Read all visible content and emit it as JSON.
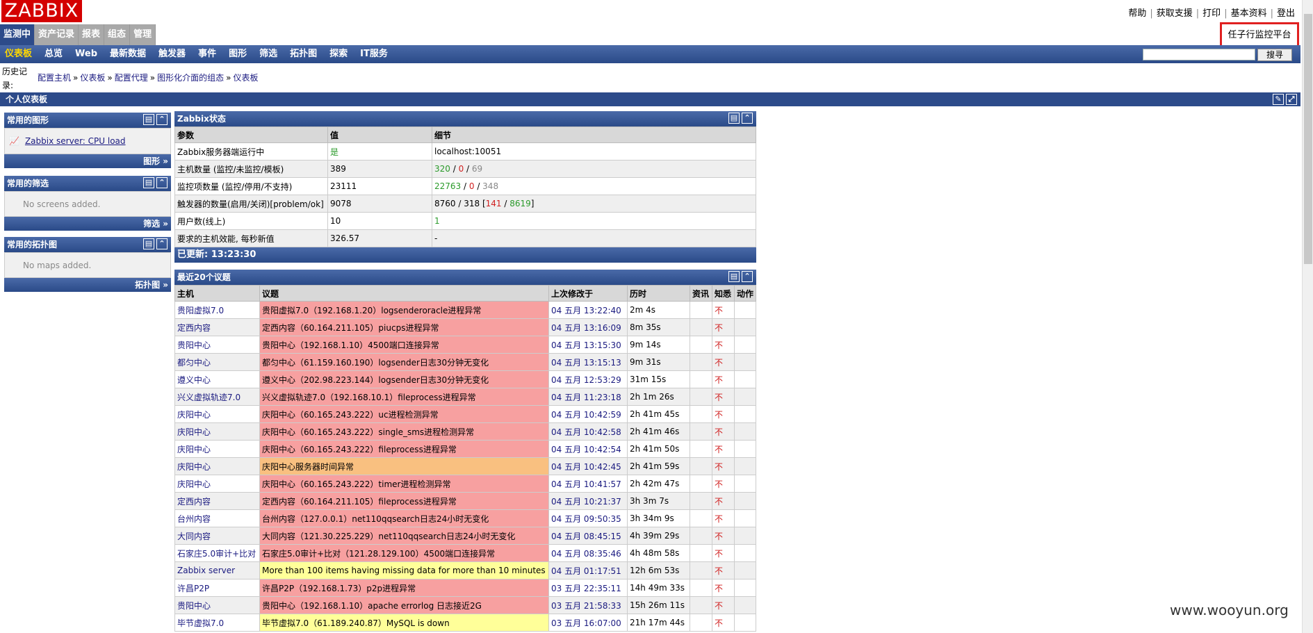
{
  "logo": "ZABBIX",
  "top_links": [
    "帮助",
    "获取支援",
    "打印",
    "基本资料",
    "登出"
  ],
  "main_menu": [
    "监测中",
    "资产记录",
    "报表",
    "组态",
    "管理"
  ],
  "platform_label": "任子行监控平台",
  "sub_menu": [
    "仪表板",
    "总览",
    "Web",
    "最新数据",
    "触发器",
    "事件",
    "图形",
    "筛选",
    "拓扑图",
    "探索",
    "IT服务"
  ],
  "search": {
    "button": "搜寻"
  },
  "history_label": "历史记录:",
  "breadcrumbs": [
    "配置主机",
    "仪表板",
    "配置代理",
    "图形化介面的组态",
    "仪表板"
  ],
  "dashboard_title": "个人仪表板",
  "widgets": {
    "graphs": {
      "title": "常用的图形",
      "item": "Zabbix server: CPU load",
      "footer": "图形 »"
    },
    "screens": {
      "title": "常用的筛选",
      "empty": "No screens added.",
      "footer": "筛选 »"
    },
    "maps": {
      "title": "常用的拓扑图",
      "empty": "No maps added.",
      "footer": "拓扑图 »"
    }
  },
  "status": {
    "title": "Zabbix状态",
    "headers": [
      "参数",
      "值",
      "细节"
    ],
    "rows": [
      {
        "param": "Zabbix服务器端运行中",
        "value": "是",
        "detail": "localhost:10051"
      },
      {
        "param": "主机数量 (监控/未监控/模板)",
        "value": "389",
        "d1": "320",
        "d2": "0",
        "d3": "69"
      },
      {
        "param": "监控项数量 (监控/停用/不支持)",
        "value": "23111",
        "d1": "22763",
        "d2": "0",
        "d3": "348"
      },
      {
        "param": "触发器的数量(启用/关闭)[problem/ok]",
        "value": "9078",
        "d1": "8760",
        "d2": "318",
        "d3": "141",
        "d4": "8619"
      },
      {
        "param": "用户数(线上)",
        "value": "10",
        "detail": "1"
      },
      {
        "param": "要求的主机效能, 每秒新值",
        "value": "326.57",
        "detail": "-"
      }
    ],
    "updated": "已更新: 13:23:30"
  },
  "issues": {
    "title": "最近20个议题",
    "headers": [
      "主机",
      "议题",
      "上次修改于",
      "历时",
      "资讯",
      "知悉",
      "动作"
    ],
    "rows": [
      {
        "host": "贵阳虚拟7.0",
        "issue": "贵阳虚拟7.0（192.168.1.20）logsenderoracle进程异常",
        "time": "04 五月 13:22:40",
        "age": "2m 4s",
        "ack": "不",
        "sev": "red"
      },
      {
        "host": "定西内容",
        "issue": "定西内容（60.164.211.105）piucps进程异常",
        "time": "04 五月 13:16:09",
        "age": "8m 35s",
        "ack": "不",
        "sev": "red"
      },
      {
        "host": "贵阳中心",
        "issue": "贵阳中心（192.168.1.10）4500端口连接异常",
        "time": "04 五月 13:15:30",
        "age": "9m 14s",
        "ack": "不",
        "sev": "red"
      },
      {
        "host": "都匀中心",
        "issue": "都匀中心（61.159.160.190）logsender日志30分钟无变化",
        "time": "04 五月 13:15:13",
        "age": "9m 31s",
        "ack": "不",
        "sev": "red"
      },
      {
        "host": "遵义中心",
        "issue": "遵义中心（202.98.223.144）logsender日志30分钟无变化",
        "time": "04 五月 12:53:29",
        "age": "31m 15s",
        "ack": "不",
        "sev": "red"
      },
      {
        "host": "兴义虚拟轨迹7.0",
        "issue": "兴义虚拟轨迹7.0（192.168.10.1）fileprocess进程异常",
        "time": "04 五月 11:23:18",
        "age": "2h 1m 26s",
        "ack": "不",
        "sev": "red"
      },
      {
        "host": "庆阳中心",
        "issue": "庆阳中心（60.165.243.222）uc进程检测异常",
        "time": "04 五月 10:42:59",
        "age": "2h 41m 45s",
        "ack": "不",
        "sev": "red"
      },
      {
        "host": "庆阳中心",
        "issue": "庆阳中心（60.165.243.222）single_sms进程检测异常",
        "time": "04 五月 10:42:58",
        "age": "2h 41m 46s",
        "ack": "不",
        "sev": "red"
      },
      {
        "host": "庆阳中心",
        "issue": "庆阳中心（60.165.243.222）fileprocess进程异常",
        "time": "04 五月 10:42:54",
        "age": "2h 41m 50s",
        "ack": "不",
        "sev": "red"
      },
      {
        "host": "庆阳中心",
        "issue": "庆阳中心服务器时间异常",
        "time": "04 五月 10:42:45",
        "age": "2h 41m 59s",
        "ack": "不",
        "sev": "orange"
      },
      {
        "host": "庆阳中心",
        "issue": "庆阳中心（60.165.243.222）timer进程检测异常",
        "time": "04 五月 10:41:57",
        "age": "2h 42m 47s",
        "ack": "不",
        "sev": "red"
      },
      {
        "host": "定西内容",
        "issue": "定西内容（60.164.211.105）fileprocess进程异常",
        "time": "04 五月 10:21:37",
        "age": "3h 3m 7s",
        "ack": "不",
        "sev": "red"
      },
      {
        "host": "台州内容",
        "issue": "台州内容（127.0.0.1）net110qqsearch日志24小时无变化",
        "time": "04 五月 09:50:35",
        "age": "3h 34m 9s",
        "ack": "不",
        "sev": "red"
      },
      {
        "host": "大同内容",
        "issue": "大同内容（121.30.225.229）net110qqsearch日志24小时无变化",
        "time": "04 五月 08:45:15",
        "age": "4h 39m 29s",
        "ack": "不",
        "sev": "red"
      },
      {
        "host": "石家庄5.0审计+比对",
        "issue": "石家庄5.0审计+比对（121.28.129.100）4500端口连接异常",
        "time": "04 五月 08:35:46",
        "age": "4h 48m 58s",
        "ack": "不",
        "sev": "red"
      },
      {
        "host": "Zabbix server",
        "issue": "More than 100 items having missing data for more than 10 minutes",
        "time": "04 五月 01:17:51",
        "age": "12h 6m 53s",
        "ack": "不",
        "sev": "yellow"
      },
      {
        "host": "许昌P2P",
        "issue": "许昌P2P（192.168.1.73）p2p进程异常",
        "time": "03 五月 22:35:11",
        "age": "14h 49m 33s",
        "ack": "不",
        "sev": "red"
      },
      {
        "host": "贵阳中心",
        "issue": "贵阳中心（192.168.1.10）apache errorlog 日志接近2G",
        "time": "03 五月 21:58:33",
        "age": "15h 26m 11s",
        "ack": "不",
        "sev": "red"
      },
      {
        "host": "毕节虚拟7.0",
        "issue": "毕节虚拟7.0（61.189.240.87）MySQL is down",
        "time": "03 五月 16:07:00",
        "age": "21h 17m 44s",
        "ack": "不",
        "sev": "yellow"
      }
    ]
  },
  "watermark": "www.wooyun.org",
  "colors": {
    "nav": "#2d4b8a",
    "problem": "#f7a0a0",
    "warning": "#f9c080",
    "info": "#ffff99",
    "logo": "#d40000"
  }
}
